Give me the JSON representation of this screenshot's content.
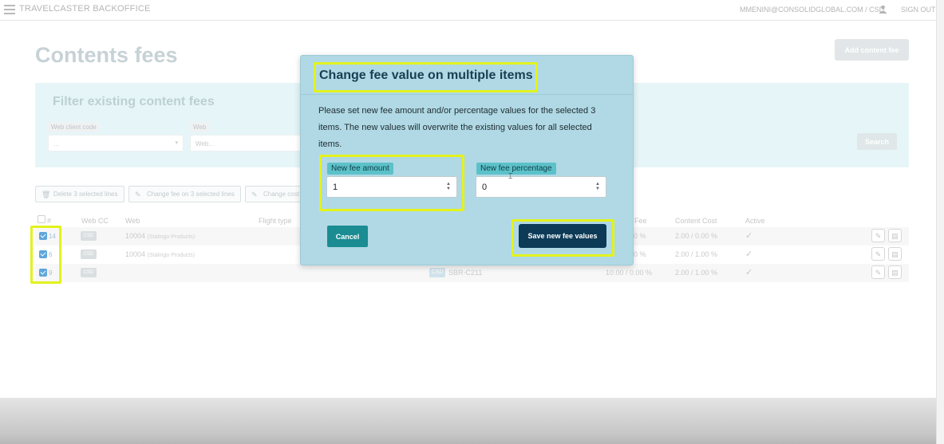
{
  "app": {
    "title": "TRAVELCASTER BACKOFFICE",
    "user": "MMENINI@CONSOLIDGLOBAL.COM / CSD",
    "signout": "SIGN OUT ("
  },
  "page": {
    "title": "Contents fees",
    "add_button": "Add content fee"
  },
  "filter": {
    "title": "Filter existing content fees",
    "web_client_label": "Web client code",
    "web_client_value": "...",
    "web_label": "Web",
    "web_placeholder": "Web...",
    "search_button": "Search"
  },
  "actions": {
    "delete": "Delete 3 selected lines",
    "change_fee": "Change fee on 3 selected lines",
    "change_cost": "Change cost"
  },
  "table": {
    "headers": {
      "num": "#",
      "webcc": "Web CC",
      "web": "Web",
      "flight": "Flight type",
      "fee": "Fee",
      "content_cost": "Content Cost",
      "active": "Active"
    },
    "rows": [
      {
        "id": "14",
        "cc": "CSD",
        "web": "10004",
        "web_sub": "(Stalingo Products)",
        "csd": "",
        "code": "",
        "fee": "0 %",
        "cost": "2.00 / 0.00 %"
      },
      {
        "id": "6",
        "cc": "CSD",
        "web": "10004",
        "web_sub": "(Stalingo Products)",
        "csd": "",
        "code": "",
        "fee": "0 %",
        "cost": "2.00 / 1.00 %"
      },
      {
        "id": "9",
        "cc": "CSD",
        "web": "",
        "web_sub": "",
        "csd": "CSD",
        "code": "SBR-C211",
        "fee": "10.00 / 0.00 %",
        "cost": "2.00 / 1.00 %"
      }
    ]
  },
  "modal": {
    "title": "Change fee value on multiple items",
    "description": "Please set new fee amount and/or percentage values for the selected 3 items. The new values will overwrite the existing values for all selected items.",
    "amount_label": "New fee amount",
    "amount_value": "1",
    "percentage_label": "New fee percentage",
    "percentage_value": "0",
    "cancel": "Cancel",
    "save": "Save new fee values"
  },
  "colors": {
    "highlight": "#e3f21d",
    "modal_bg": "#b0d9e5",
    "primary": "#0d3b57",
    "teal": "#1a8c92"
  }
}
